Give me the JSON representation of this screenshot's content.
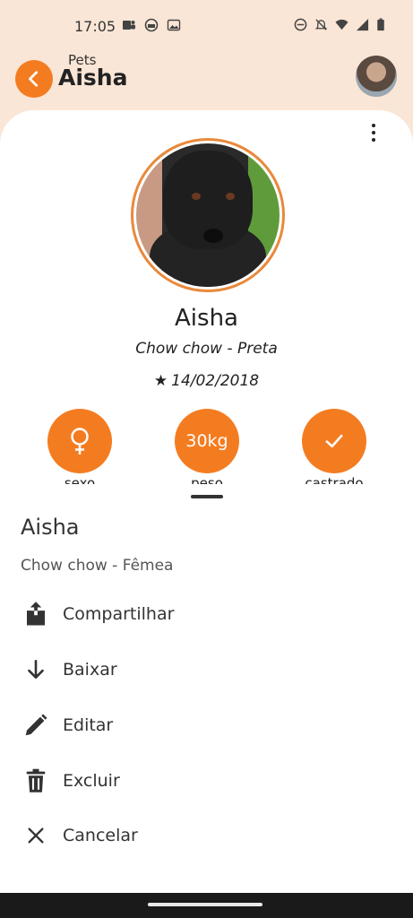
{
  "status_bar": {
    "time": "17:05",
    "left_icons": [
      "teams-icon",
      "app-icon",
      "image-icon"
    ],
    "right_icons": [
      "dnd-icon",
      "bell-off-icon",
      "wifi-icon",
      "signal-icon",
      "battery-icon"
    ]
  },
  "header": {
    "breadcrumb": "Pets",
    "title": "Aisha",
    "back_icon": "chevron-left-icon",
    "accent_color": "#f47c20"
  },
  "pet": {
    "name": "Aisha",
    "breed_color": "Chow chow - Preta",
    "birth_date": "14/02/2018",
    "birth_icon": "★"
  },
  "stats": [
    {
      "value": "",
      "icon": "female-icon",
      "label": "sexo"
    },
    {
      "value": "30kg",
      "label": "peso"
    },
    {
      "value": "",
      "icon": "check-icon",
      "label": "castrado"
    }
  ],
  "sheet": {
    "title": "Aisha",
    "subtitle": "Chow chow - Fêmea",
    "items": [
      {
        "label": "Compartilhar",
        "icon": "share-icon"
      },
      {
        "label": "Baixar",
        "icon": "download-icon"
      },
      {
        "label": "Editar",
        "icon": "edit-icon"
      },
      {
        "label": "Excluir",
        "icon": "delete-icon"
      },
      {
        "label": "Cancelar",
        "icon": "close-icon"
      }
    ]
  }
}
